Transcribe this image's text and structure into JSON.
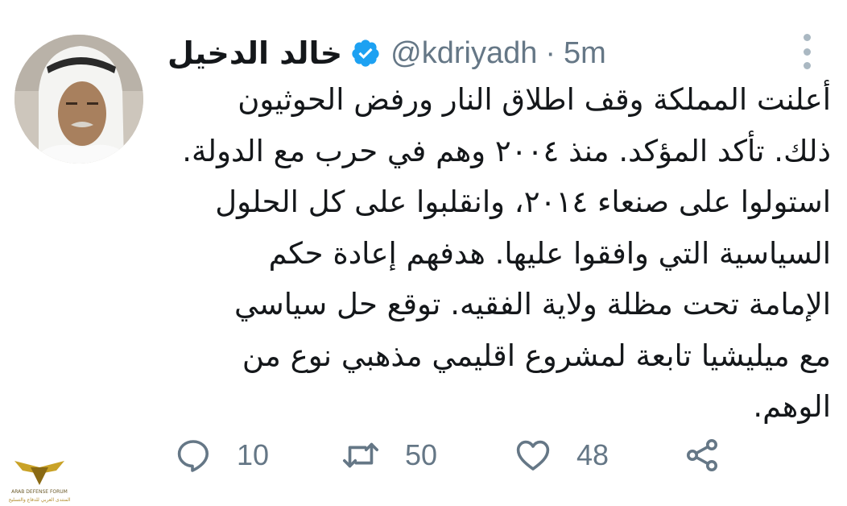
{
  "tweet": {
    "display_name": "خالد الدخيل",
    "handle": "@kdriyadh",
    "separator": "·",
    "time": "5m",
    "text_lines": [
      "أعلنت المملكة وقف اطلاق النار ورفض الحوثيون",
      "ذلك. تأكد المؤكد. منذ ٢٠٠٤ وهم في حرب مع الدولة.",
      "استولوا على صنعاء ٢٠١٤، وانقلبوا على كل الحلول",
      "السياسية التي وافقوا عليها. هدفهم إعادة حكم",
      "الإمامة تحت مظلة ولاية الفقيه. توقع حل سياسي",
      "مع ميليشيا تابعة لمشروع اقليمي مذهبي نوع من",
      "الوهم."
    ],
    "actions": {
      "reply_count": "10",
      "retweet_count": "50",
      "like_count": "48"
    }
  },
  "colors": {
    "verified_blue": "#1da1f2",
    "icon_gray": "#657786",
    "text": "#14171a"
  },
  "icons": [
    "verified-icon",
    "more-icon",
    "reply-icon",
    "retweet-icon",
    "like-icon",
    "share-icon"
  ],
  "watermark": {
    "line1": "ARAB DEFENSE FORUM",
    "line2": "المنتدى العربي للدفاع والتسليح"
  }
}
